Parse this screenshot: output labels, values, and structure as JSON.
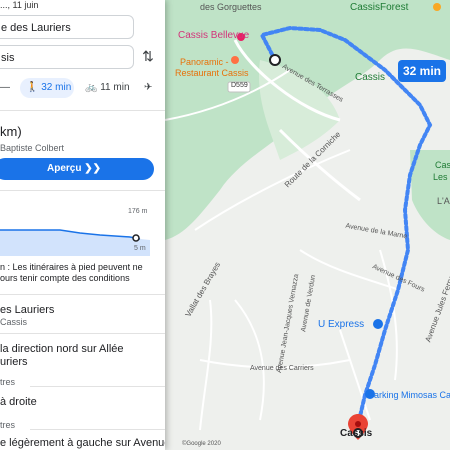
{
  "panel": {
    "date_text": "..., 11 juin",
    "from_value": "e des Lauriers",
    "to_value": "sis",
    "modes": [
      {
        "icon": "car-icon",
        "label": ""
      },
      {
        "icon": "walk-icon",
        "label": "32 min"
      },
      {
        "icon": "bike-icon",
        "label": "11 min"
      },
      {
        "icon": "plane-icon",
        "label": ""
      }
    ],
    "route_summary": "km)",
    "route_via": "Baptiste Colbert",
    "preview_label": "Aperçu",
    "elev_top": "176 m",
    "elev_bottom": "5 m",
    "warning_line1": "n : Les itinéraires à pied peuvent ne",
    "warning_line2": "ours tenir compte des conditions",
    "start_title": "es Lauriers",
    "start_sub": "Cassis",
    "step1_line1": "la direction nord sur Allée",
    "step1_line2": "uriers",
    "dist1": "tres",
    "step2": "à droite",
    "dist2": "tres",
    "step3": "e légèrement à gauche sur Avenue"
  },
  "map": {
    "route_time": "32 min",
    "labels": {
      "gorguettes": "des Gorguettes",
      "cassisforest": "CassisForest",
      "cassis_bellevue": "Cassis Bellevue",
      "panoramic1": "Panoramic -",
      "panoramic2": "Restaurant Cassis",
      "d559": "D559",
      "terrasses": "Avenue des Terrasses",
      "corniche": "Route de la Corniche",
      "cassis_r": "Cassis",
      "cass_right": "Cass",
      "les_r": "Les",
      "lam": "L'Am",
      "marne": "Avenue de la Marne",
      "fours": "Avenue des Fours",
      "jules_ferry": "Avenue Jules Ferry",
      "brayes": "Vallat des Brayes",
      "verdun": "Avenue de Verdun",
      "jjv": "Avenue Jean-Jacques Vernazza",
      "uexpress": "U Express",
      "carriers": "Avenue des Carriers",
      "parking": "Parking Mimosas Cassis",
      "dest": "Cassis",
      "copyright": "©Google 2020"
    }
  }
}
